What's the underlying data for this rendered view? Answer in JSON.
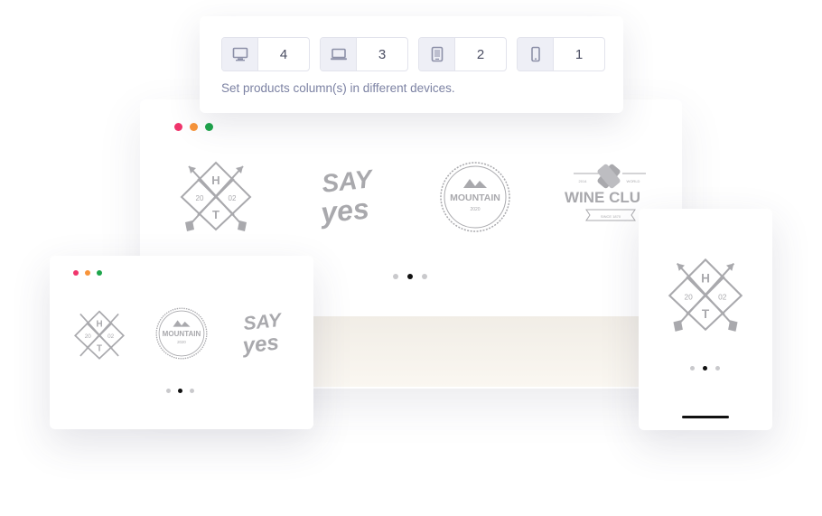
{
  "settings": {
    "devices": [
      {
        "icon": "desktop-icon",
        "value": "4"
      },
      {
        "icon": "laptop-icon",
        "value": "3"
      },
      {
        "icon": "tablet-icon",
        "value": "2"
      },
      {
        "icon": "mobile-icon",
        "value": "1"
      }
    ],
    "caption": "Set products column(s) in different devices."
  },
  "window_dots": {
    "colors": [
      "#f0356c",
      "#f8943a",
      "#1ea54b"
    ]
  },
  "logos": {
    "hipster": {
      "top": "H",
      "left": "20",
      "right": "02",
      "bottom": "T"
    },
    "sayyes": {
      "line1": "SAY",
      "line2": "yes"
    },
    "mountain": {
      "name": "MOUNTAIN",
      "year": "2020"
    },
    "wine": {
      "name": "WINE CLU",
      "small_left": "2014",
      "small_right": "WORLD",
      "ribbon": "SINCE 1870"
    }
  },
  "colors": {
    "logo_gray": "#a9a9ad",
    "accent_text": "#7c82a3",
    "active_dot": "#111111",
    "inactive_dot": "#c9c9cc"
  }
}
